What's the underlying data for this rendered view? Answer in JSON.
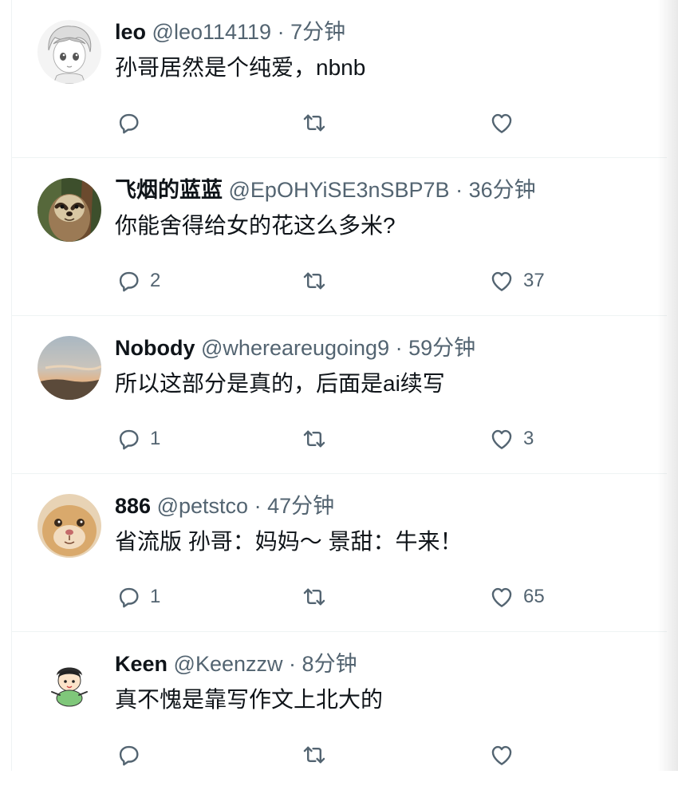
{
  "replies": [
    {
      "name": "leo",
      "handle": "@leo114119",
      "separator": "·",
      "time": "7分钟",
      "text": "孙哥居然是个纯爱，nbnb",
      "reply_count": "",
      "retweet_count": "",
      "like_count": ""
    },
    {
      "name": "飞烟的蓝蓝",
      "handle": "@EpOHYiSE3nSBP7B",
      "separator": "·",
      "time": "36分钟",
      "text": "你能舍得给女的花这么多米?",
      "reply_count": "2",
      "retweet_count": "",
      "like_count": "37"
    },
    {
      "name": "Nobody",
      "handle": "@whereareugoing9",
      "separator": "·",
      "time": "59分钟",
      "text": "所以这部分是真的，后面是ai续写",
      "reply_count": "1",
      "retweet_count": "",
      "like_count": "3"
    },
    {
      "name": "886",
      "handle": "@petstco",
      "separator": "·",
      "time": "47分钟",
      "text": "省流版 孙哥：妈妈～ 景甜：牛来！",
      "reply_count": "1",
      "retweet_count": "",
      "like_count": "65"
    },
    {
      "name": "Keen",
      "handle": "@Keenzzw",
      "separator": "·",
      "time": "8分钟",
      "text": "真不愧是靠写作文上北大的",
      "reply_count": "",
      "retweet_count": "",
      "like_count": ""
    }
  ],
  "icons": {
    "reply": "reply-icon",
    "retweet": "retweet-icon",
    "like": "heart-icon"
  },
  "colors": {
    "text": "#0f1419",
    "secondary": "#536471",
    "divider": "#eff3f4"
  }
}
